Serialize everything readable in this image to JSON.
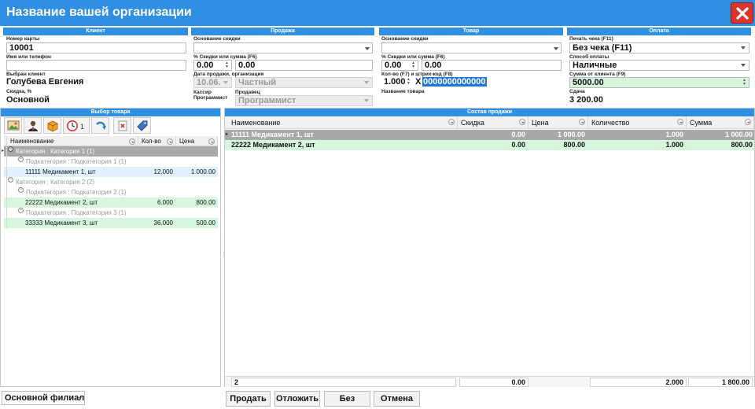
{
  "window": {
    "title": "Название вашей организации"
  },
  "client": {
    "header": "Клиент",
    "card_label": "Номер карты",
    "card_value": "10001",
    "name_label": "Имя или телефон",
    "name_value": "",
    "selected_label": "Выбран клиент",
    "selected_value": "Голубева Евгения",
    "discount_label": "Скидка, %",
    "discount_value": "Основной"
  },
  "sale": {
    "header": "Продажа",
    "basis_label": "Основание скидки",
    "basis_value": "",
    "percent_label": "% Скидки или сумма (F6)",
    "percent_value": "0.00",
    "amount_value": "0.00",
    "date_org_label": "Дата продажи, организация",
    "date_value": "10.06.",
    "org_value": "Частный",
    "cashier_label": "Кассир",
    "seller_label": "Продавец",
    "programmer_label": "Программист",
    "seller_value": "Программист"
  },
  "product": {
    "header": "Товар",
    "basis_label": "Основание скидки",
    "basis_value": "",
    "percent_label": "% Скидки или сумма (F6)",
    "percent_value": "0.00",
    "amount_value": "0.00",
    "qty_barcode_label": "Кол-во (F7) и штрих-код (F8)",
    "qty_value": "1.000",
    "times_symbol": "X",
    "barcode_value": "0000000000000",
    "name_label": "Название товара",
    "name_value": ""
  },
  "payment": {
    "header": "Оплата",
    "print_label": "Печать чека (F11)",
    "print_value": "Без чека (F11)",
    "method_label": "Способ оплаты",
    "method_value": "Наличные",
    "client_sum_label": "Сумма от клиента (F9)",
    "client_sum_value": "5000.00",
    "change_label": "Сдача",
    "change_value": "3 200.00"
  },
  "catalog": {
    "header": "Выбор товара",
    "toolbar_badge": "1",
    "columns": [
      "Наименование",
      "Кол-во",
      "Цена"
    ],
    "rows": [
      {
        "type": "category",
        "label": "Категория : Категория 1 (1)"
      },
      {
        "type": "subcategory",
        "label": "Подкатегория : Подкатегория 1 (1)"
      },
      {
        "type": "item",
        "name": "11111 Медикамент 1, шт",
        "qty": "12.000",
        "price": "1 000.00"
      },
      {
        "type": "category",
        "label": "Категория : Категория 2 (2)"
      },
      {
        "type": "subcategory",
        "label": "Подкатегория : Подкатегория 2 (1)"
      },
      {
        "type": "item",
        "name": "22222 Медикамент 2, шт",
        "qty": "6.000",
        "price": "800.00"
      },
      {
        "type": "subcategory",
        "label": "Подкатегория : Подкатегория 3 (1)"
      },
      {
        "type": "item",
        "name": "33333 Медикамент 3, шт",
        "qty": "36.000",
        "price": "500.00"
      }
    ]
  },
  "cart": {
    "header": "Состав продажи",
    "columns": [
      "Наименование",
      "Скидка",
      "Цена",
      "Количество",
      "Сумма"
    ],
    "rows": [
      {
        "name": "11111 Медикамент 1, шт",
        "discount": "0.00",
        "price": "1 000.00",
        "qty": "1.000",
        "sum": "1 000.00"
      },
      {
        "name": "22222 Медикамент 2, шт",
        "discount": "0.00",
        "price": "800.00",
        "qty": "1.000",
        "sum": "800.00"
      }
    ],
    "footer": {
      "count": "2",
      "discount": "0.00",
      "qty": "2.000",
      "sum": "1 800.00"
    }
  },
  "bottom": {
    "branch_value": "Основной филиал",
    "sell_label": "Продать",
    "postpone_label": "Отложить",
    "nocheck_label": "Без",
    "cancel_label": "Отмена"
  },
  "colors": {
    "accent": "#2e8fe3",
    "selected_row": "#d6f7dd",
    "highlight_row": "#dff2fb",
    "category_row": "#a9a9a9",
    "close": "#d9352a"
  }
}
